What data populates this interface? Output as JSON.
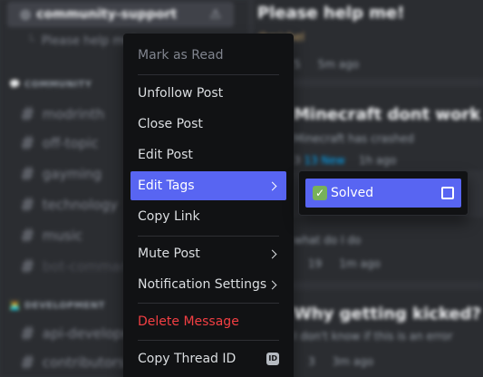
{
  "sidebar": {
    "selected_channel": "community-support",
    "sub_thread": "Please help me!",
    "categories": [
      {
        "label": "💬 COMMUNITY",
        "channels": [
          "modrinth",
          "off-topic",
          "gayming",
          "technology",
          "music",
          "bot-commands"
        ]
      },
      {
        "label": "👨‍💻 DEVELOPMENT",
        "channels": [
          "api-development",
          "contributors"
        ]
      }
    ]
  },
  "posts": [
    {
      "title": "Please help me!",
      "author": "@michel",
      "count": "5",
      "time": "5m ago"
    },
    {
      "title": "Minecraft dont work ):",
      "preview": "Minecraft has crashed",
      "count": "3",
      "link": "13 New",
      "time": "1h ago"
    },
    {
      "preview": "what do I do",
      "count": "19",
      "time": "1m ago"
    },
    {
      "title": "Why getting kicked?",
      "preview": "I don't know if this is an error",
      "count": "3",
      "time": "3m ago"
    }
  ],
  "context_menu": {
    "items": [
      {
        "label": "Mark as Read",
        "state": "disabled"
      },
      {
        "label": "Unfollow Post"
      },
      {
        "label": "Close Post"
      },
      {
        "label": "Edit Post"
      },
      {
        "label": "Edit Tags",
        "state": "active",
        "submenu": true
      },
      {
        "label": "Copy Link"
      },
      {
        "label": "Mute Post",
        "submenu": true
      },
      {
        "label": "Notification Settings",
        "submenu": true
      },
      {
        "label": "Delete Message",
        "state": "danger"
      },
      {
        "label": "Copy Thread ID",
        "badge": "ID"
      }
    ]
  },
  "tags_submenu": {
    "items": [
      {
        "label": "Solved",
        "emoji": "check-mark-button",
        "checked": false
      }
    ]
  },
  "colors": {
    "accent": "#5865f2",
    "danger": "#f23f43",
    "menu_bg": "#111214",
    "tag_emoji": "#78b159"
  }
}
